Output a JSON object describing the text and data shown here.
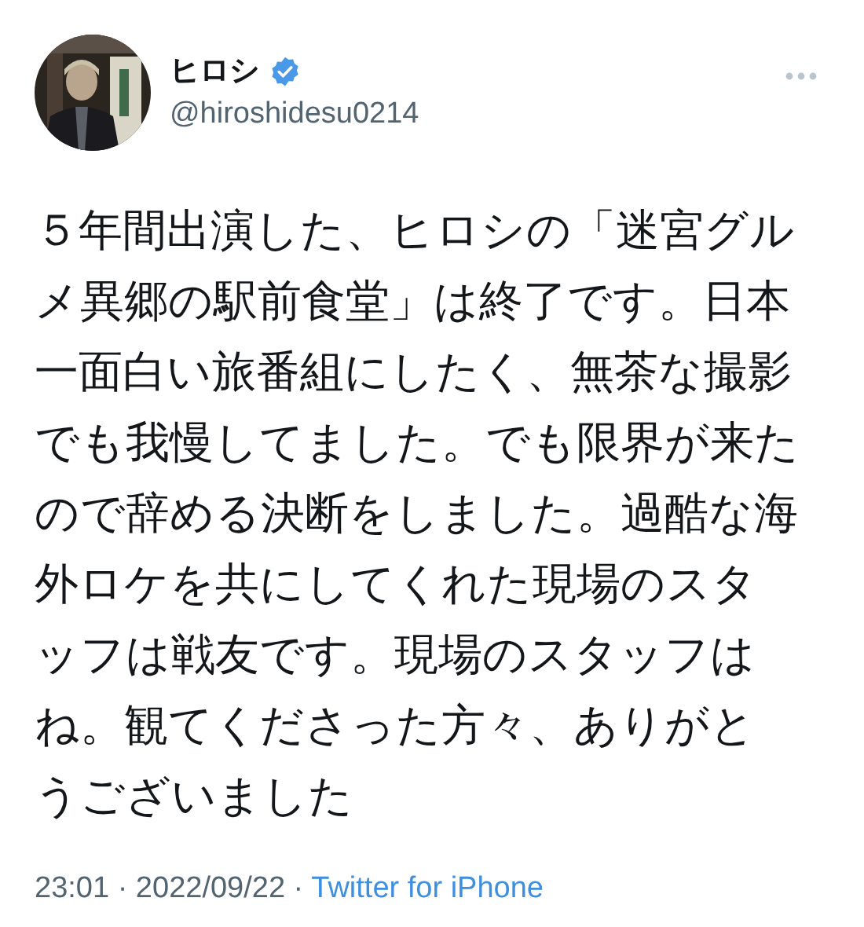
{
  "tweet": {
    "author": {
      "name": "ヒロシ",
      "verified": true,
      "handle": "@hiroshidesu0214"
    },
    "text": "５年間出演した、ヒロシの「迷宮グルメ異郷の駅前食堂」は終了です。日本一面白い旅番組にしたく、無茶な撮影でも我慢してました。でも限界が来たので辞める決断をしました。過酷な海外ロケを共にしてくれた現場のスタッフは戦友です。現場のスタッフはね。観てくださった方々、ありがとうございました",
    "time": "23:01 ·",
    "date": "2022/09/22 ·",
    "source": "Twitter for iPhone"
  }
}
